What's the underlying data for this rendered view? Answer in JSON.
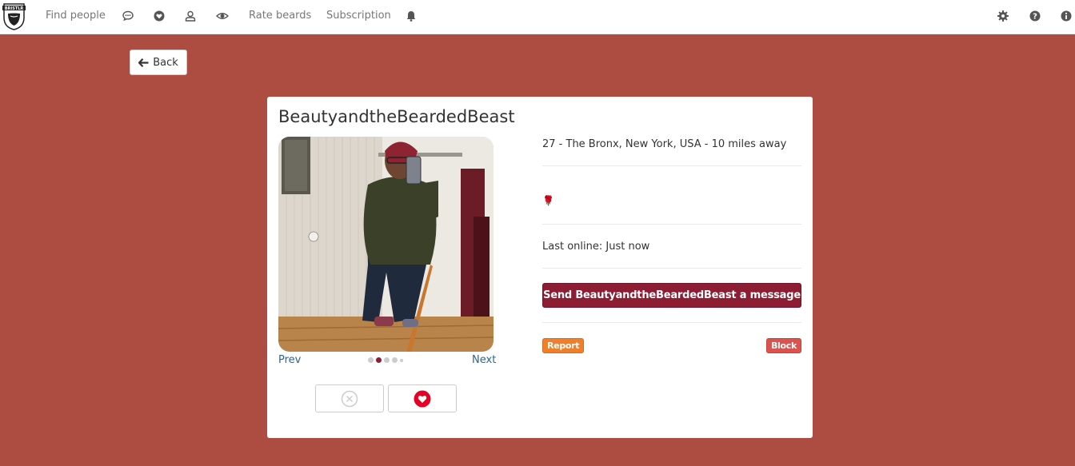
{
  "nav": {
    "logo_text": "BRISTLR",
    "find_people": "Find people",
    "rate_beards": "Rate beards",
    "subscription": "Subscription",
    "icons": [
      "chat-icon",
      "heart-icon",
      "user-icon",
      "eye-icon",
      "bell-icon",
      "gear-icon",
      "question-icon",
      "info-icon"
    ]
  },
  "back": {
    "label": "Back"
  },
  "profile": {
    "username": "BeautyandtheBeardedBeast",
    "details": "27 - The Bronx, New York, USA - 10 miles away",
    "emoji": "🌹",
    "last_online": "Last online: Just now",
    "message_button": "Send BeautyandtheBeardedBeast a message",
    "report": "Report",
    "block": "Block"
  },
  "photos": {
    "prev": "Prev",
    "next": "Next",
    "count": 5,
    "active_index": 1
  },
  "colors": {
    "background": "#ad4c41",
    "primary": "#8d1d33",
    "report": "#ee7f2d",
    "block": "#d9534f",
    "like": "#e60023"
  }
}
